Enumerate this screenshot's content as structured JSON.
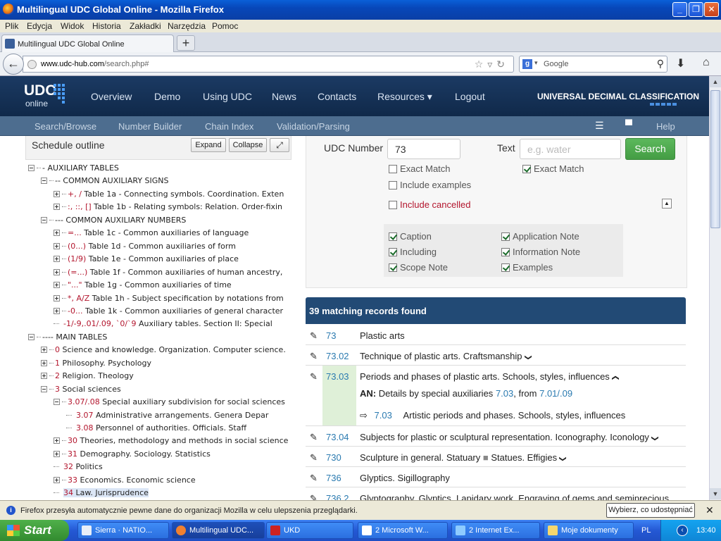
{
  "window": {
    "title": "Multilingual UDC Global Online - Mozilla Firefox"
  },
  "menu": [
    "Plik",
    "Edycja",
    "Widok",
    "Historia",
    "Zakładki",
    "Narzędzia",
    "Pomoc"
  ],
  "tab": {
    "label": "Multilingual UDC Global Online"
  },
  "address": {
    "host": "www.udc-hub.com",
    "path": "/search.php#"
  },
  "search_engine": {
    "placeholder": "Google"
  },
  "site": {
    "logo_main": "UDC",
    "logo_sub": "online",
    "nav": [
      "Overview",
      "Demo",
      "Using UDC",
      "News",
      "Contacts",
      "Resources ▾",
      "Logout"
    ],
    "brand": "UNIVERSAL DECIMAL CLASSIFICATION",
    "subnav": [
      "Search/Browse",
      "Number Builder",
      "Chain Index",
      "Validation/Parsing"
    ],
    "help": "Help"
  },
  "outline": {
    "title": "Schedule outline",
    "expand": "Expand",
    "collapse": "Collapse",
    "rows": [
      {
        "indent": 0,
        "tog": "minus",
        "notation": "",
        "text": "- AUXILIARY TABLES"
      },
      {
        "indent": 1,
        "tog": "minus",
        "notation": "",
        "text": "-- COMMON AUXILIARY SIGNS"
      },
      {
        "indent": 2,
        "tog": "plus",
        "notation": "+, /",
        "text": " Table 1a - Connecting symbols. Coordination. Exten"
      },
      {
        "indent": 2,
        "tog": "plus",
        "notation": ":, ::, []",
        "text": " Table 1b - Relating symbols: Relation. Order-fixin"
      },
      {
        "indent": 1,
        "tog": "minus",
        "notation": "",
        "text": "--- COMMON AUXILIARY NUMBERS"
      },
      {
        "indent": 2,
        "tog": "plus",
        "notation": "=...",
        "text": " Table 1c - Common auxiliaries of language"
      },
      {
        "indent": 2,
        "tog": "plus",
        "notation": "(0...)",
        "text": " Table 1d - Common auxiliaries of form"
      },
      {
        "indent": 2,
        "tog": "plus",
        "notation": "(1/9)",
        "text": " Table 1e - Common auxiliaries of place"
      },
      {
        "indent": 2,
        "tog": "plus",
        "notation": "(=...)",
        "text": " Table 1f - Common auxiliaries of human ancestry,"
      },
      {
        "indent": 2,
        "tog": "plus",
        "notation": "\"...\"",
        "text": " Table 1g - Common auxiliaries of time"
      },
      {
        "indent": 2,
        "tog": "plus",
        "notation": "*, A/Z",
        "text": " Table 1h - Subject specification by notations from"
      },
      {
        "indent": 2,
        "tog": "plus",
        "notation": "-0...",
        "text": " Table 1k - Common auxiliaries of general character"
      },
      {
        "indent": 2,
        "tog": "none",
        "notation": "-1/-9,.01/.09, `0/`9",
        "text": " Auxiliary tables. Section II: Special"
      },
      {
        "indent": 0,
        "tog": "minus",
        "notation": "",
        "text": "---- MAIN TABLES"
      },
      {
        "indent": 1,
        "tog": "plus",
        "notation": "0",
        "text": " Science and knowledge. Organization. Computer science."
      },
      {
        "indent": 1,
        "tog": "plus",
        "notation": "1",
        "text": " Philosophy. Psychology"
      },
      {
        "indent": 1,
        "tog": "plus",
        "notation": "2",
        "text": " Religion. Theology"
      },
      {
        "indent": 1,
        "tog": "minus",
        "notation": "3",
        "text": " Social sciences"
      },
      {
        "indent": 2,
        "tog": "minus",
        "notation": "3.07/.08",
        "text": " Special auxiliary subdivision for social sciences"
      },
      {
        "indent": 3,
        "tog": "none",
        "notation": "3.07",
        "text": " Administrative arrangements. Genera Depar"
      },
      {
        "indent": 3,
        "tog": "none",
        "notation": "3.08",
        "text": " Personnel of authorities. Officials. Staff"
      },
      {
        "indent": 2,
        "tog": "plus",
        "notation": "30",
        "text": " Theories, methodology and methods in social science"
      },
      {
        "indent": 2,
        "tog": "plus",
        "notation": "31",
        "text": " Demography. Sociology. Statistics"
      },
      {
        "indent": 2,
        "tog": "none",
        "notation": "32",
        "text": " Politics"
      },
      {
        "indent": 2,
        "tog": "plus",
        "notation": "33",
        "text": " Economics. Economic science"
      },
      {
        "indent": 2,
        "tog": "none",
        "notation": "34",
        "text": " Law. Jurisprudence",
        "selected": true
      }
    ]
  },
  "search": {
    "udc_label": "UDC Number",
    "udc_value": "73",
    "text_label": "Text",
    "text_placeholder": "e.g. water",
    "button": "Search",
    "exact_match_udc": "Exact Match",
    "exact_match_text": "Exact Match",
    "include_examples": "Include examples",
    "include_cancelled": "Include cancelled",
    "fields_left": [
      "Caption",
      "Including",
      "Scope Note"
    ],
    "fields_right": [
      "Application Note",
      "Information Note",
      "Examples"
    ]
  },
  "results": {
    "header": "39 matching records found",
    "rows": [
      {
        "num": "73",
        "caption": "Plastic arts",
        "chev": ""
      },
      {
        "num": "73.02",
        "caption": "Technique of plastic arts. Craftsmanship",
        "chev": "down"
      },
      {
        "num": "73.03",
        "caption": "Periods and phases of plastic arts. Schools, styles, influences",
        "chev": "up"
      },
      {
        "num": "73.04",
        "caption": "Subjects for plastic or sculptural representation. Iconography. Iconology",
        "chev": "down"
      },
      {
        "num": "730",
        "caption": "Sculpture in general. Statuary",
        "extra": "Statues. Effigies",
        "chev": "down"
      },
      {
        "num": "736",
        "caption": "Glyptics. Sigillography",
        "chev": ""
      },
      {
        "num": "736.2",
        "caption": "Glyptography. Glyptics. Lapidary work. Engraving of gems and semiprecious",
        "chev": ""
      }
    ],
    "note_label": "AN:",
    "note_text": "Details by special auxiliaries",
    "note_link1": "7.03",
    "note_mid": ", from",
    "note_link2": "7.01/.09",
    "ref_arrow": "⇨",
    "ref_num": "7.03",
    "ref_text": "Artistic periods and phases. Schools, styles, influences"
  },
  "infobar": {
    "message": "Firefox przesyła automatycznie pewne dane do organizacji Mozilla w celu ulepszenia przeglądarki.",
    "button": "Wybierz, co udostępniać"
  },
  "taskbar": {
    "start": "Start",
    "tasks": [
      "Sierra · NATIO...",
      "Multilingual UDC...",
      "UKD",
      "2 Microsoft W...",
      "2 Internet Ex...",
      "Moje dokumenty"
    ],
    "lang": "PL",
    "time": "13:40"
  }
}
